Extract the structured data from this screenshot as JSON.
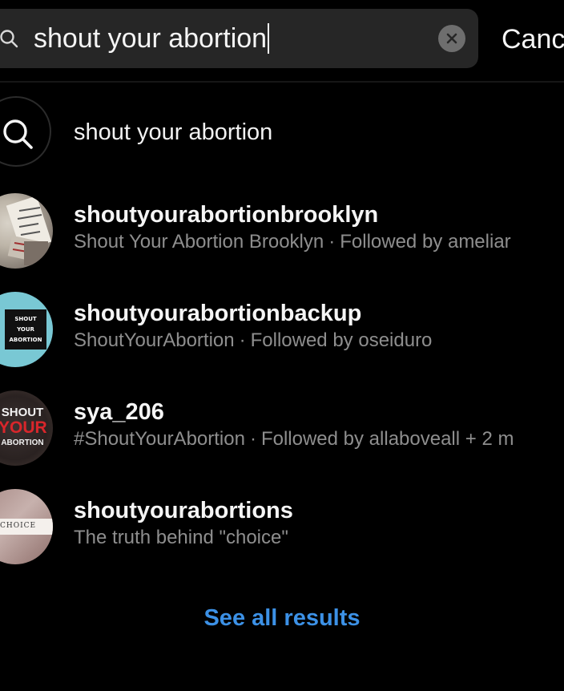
{
  "search": {
    "query": "shout your abortion",
    "cancel_label": "Canc"
  },
  "suggestion": {
    "text": "shout your abortion"
  },
  "results": [
    {
      "username": "shoutyourabortionbrooklyn",
      "name": "Shout Your Abortion Brooklyn",
      "meta": "Followed by ameliar"
    },
    {
      "username": "shoutyourabortionbackup",
      "name": "ShoutYourAbortion",
      "meta": "Followed by oseiduro",
      "avatar_text": [
        "SHOUT",
        "YOUR",
        "ABORTION"
      ]
    },
    {
      "username": "sya_206",
      "name": "#ShoutYourAbortion",
      "meta": "Followed by allaboveall + 2 m",
      "avatar_text": [
        "SHOUT",
        "YOUR",
        "ABORTION"
      ]
    },
    {
      "username": "shoutyourabortions",
      "name": "The truth behind \"choice\"",
      "meta": "",
      "avatar_text": [
        "CHOICE"
      ]
    }
  ],
  "see_all_label": "See all results",
  "separator": "·",
  "colors": {
    "background": "#000000",
    "search_field": "#262626",
    "secondary_text": "#8e8e8e",
    "link": "#3c91e6"
  },
  "icons": {
    "search": "magnifier-icon",
    "clear": "clear-circle-x-icon"
  }
}
